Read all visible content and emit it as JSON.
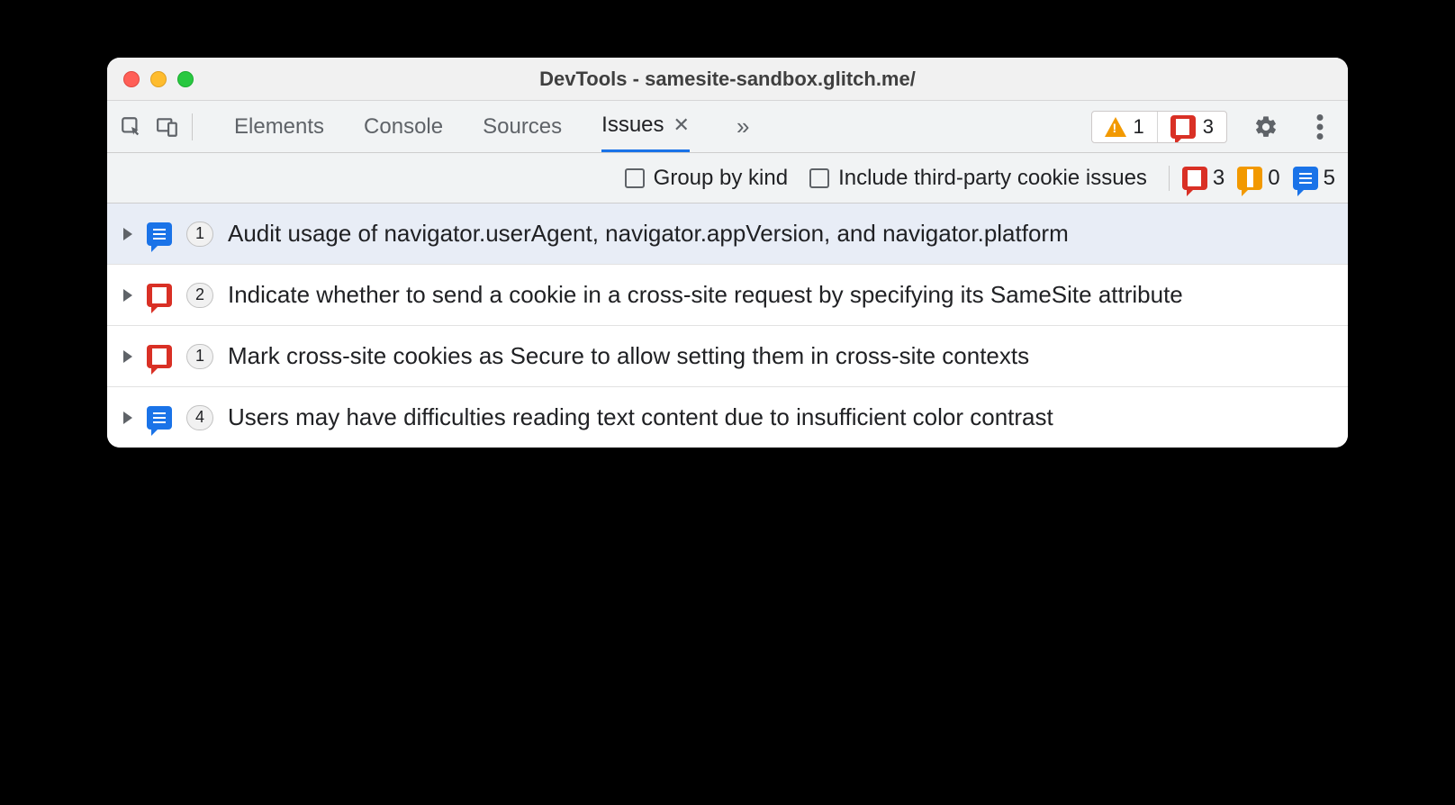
{
  "titlebar": {
    "title": "DevTools - samesite-sandbox.glitch.me/"
  },
  "tabs": {
    "items": [
      "Elements",
      "Console",
      "Sources",
      "Issues"
    ],
    "activeIndex": 3
  },
  "topCounts": {
    "warning": "1",
    "error": "3"
  },
  "options": {
    "groupByKind": "Group by kind",
    "includeThirdParty": "Include third-party cookie issues"
  },
  "flatCounts": {
    "error": "3",
    "warning": "0",
    "info": "5"
  },
  "issues": [
    {
      "kind": "info",
      "count": "1",
      "title": "Audit usage of navigator.userAgent, navigator.appVersion, and navigator.platform",
      "selected": true
    },
    {
      "kind": "error",
      "count": "2",
      "title": "Indicate whether to send a cookie in a cross-site request by specifying its SameSite attribute",
      "selected": false
    },
    {
      "kind": "error",
      "count": "1",
      "title": "Mark cross-site cookies as Secure to allow setting them in cross-site contexts",
      "selected": false
    },
    {
      "kind": "info",
      "count": "4",
      "title": "Users may have difficulties reading text content due to insufficient color contrast",
      "selected": false
    }
  ]
}
